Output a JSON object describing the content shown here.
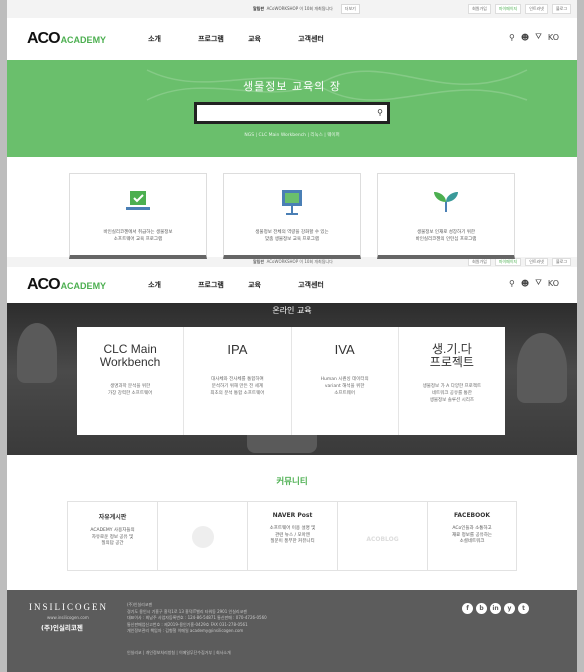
{
  "topbar": {
    "notice_label": "알림판",
    "notice_text": "ACoWORKSHOP 이 10회 개최됩니다",
    "more": "더보기",
    "links": [
      "회원가입",
      "마이페이지",
      "인트라넷",
      "블로그"
    ]
  },
  "nav": {
    "logo_main": "ACO",
    "logo_accent": "ACADEMY",
    "menu": [
      "소개",
      "프로그램",
      "교육",
      "고객센터"
    ],
    "lang": "KO"
  },
  "hero": {
    "title": "생물정보 교육의 장",
    "search_placeholder": "",
    "breadcrumb": "NGS  |  CLC Main Workbench  |  리눅스  |  웨이퍼"
  },
  "features": [
    {
      "icon": "laptop-check-icon",
      "text": "바인실리코젠에서 취급하는 생물정보\n소프트웨어 교육 프로그램"
    },
    {
      "icon": "presentation-board-icon",
      "text": "생물정보 전체의 역량을 강화할 수 있는\n맞춤 생물정보 교육 프로그램"
    },
    {
      "icon": "sprout-icon",
      "text": "생물정보 인재로 성장하기 위한\n바인실리코젠의 인턴십 프로그램"
    }
  ],
  "online": {
    "label": "온라인 교육",
    "cards": [
      {
        "title": "CLC Main\nWorkbench",
        "desc": "생명과학 분석을 위한\n가장 강력한 소프트웨어"
      },
      {
        "title": "IPA",
        "desc": "대사체와 전사체를 통합하여\n분석하기 위해 만든 전 세계\n최초의 분석 통합 소프트웨어"
      },
      {
        "title": "IVA",
        "desc": "Human 시퀀싱 데이터의\nvariant 해석을 위한\n소프트웨어"
      },
      {
        "title": "생.기.다\n프로젝트",
        "desc": "생물정보 가 A 다양한 프로젝트\n네트워크 공유를 통한\n생물정보 솔루션 시리즈"
      }
    ]
  },
  "community": {
    "title": "커뮤니티",
    "boxes": [
      {
        "heading": "자유게시판",
        "body": "ACADEMY 사용자들의\n자유로운 정보 공유 및\n질의답 공간"
      },
      {
        "heading": "",
        "body": "",
        "logo": "bioinformatics-logo-icon"
      },
      {
        "heading": "NAVER Post",
        "body": "소프트웨어 이용 설명 및\n관련 뉴스 / 모아엔\n질문이 풍부한 커뮤니티"
      },
      {
        "heading": "",
        "body": "",
        "logo_text": "ACOBLOG"
      },
      {
        "heading": "FACEBOOK",
        "body": "ACo인들과 소통하고\n재료 정보를 공유하는\n소셜네트워크"
      }
    ]
  },
  "footer": {
    "brand": "INSILICOGEN",
    "brand_sub": "www.insilicogen.com",
    "brand_korean": "(주)인실리코젠",
    "info_lines": [
      "(주)인실리코젠",
      "경기도 용인시 기흥구 흥덕1로 13 흥덕IT밸리 타워동 2901 인실리코젠",
      "대표이사 : 최남주  사업자등록번호 : 124-86-54871  통신판매 : 070-4726-0560",
      "통신판매업신고번호 : 제2019-용인기흥-0429호  FAX 031-278-0561",
      "개인정보관리 책임자 : 김형철  이메일 academy@insilicogen.com"
    ],
    "bottom_links": "인실리코  |  개인정보처리방침  |  이메일무단수집거부  |  회사소개",
    "social": [
      "f",
      "b",
      "in",
      "y",
      "t"
    ]
  },
  "colors": {
    "accent": "#4caf50",
    "hero_bg": "#6abf6c",
    "footer_bg": "#5c5c5c"
  }
}
